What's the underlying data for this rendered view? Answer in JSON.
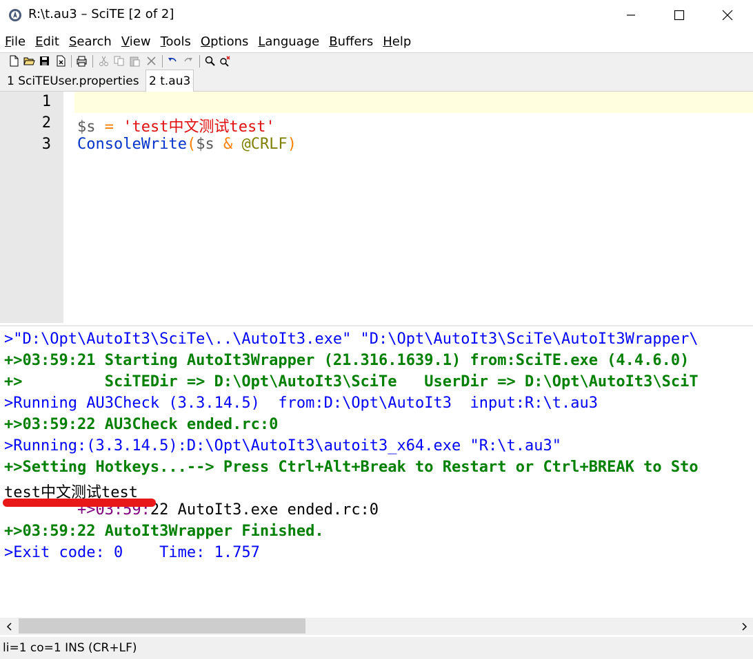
{
  "window": {
    "title": "R:\\t.au3 – SciTE [2 of 2]"
  },
  "menu": [
    {
      "mn": "F",
      "rest": "ile"
    },
    {
      "mn": "E",
      "rest": "dit"
    },
    {
      "mn": "S",
      "rest": "earch"
    },
    {
      "mn": "V",
      "rest": "iew"
    },
    {
      "mn": "T",
      "rest": "ools"
    },
    {
      "mn": "O",
      "rest": "ptions"
    },
    {
      "mn": "L",
      "rest": "anguage"
    },
    {
      "mn": "B",
      "rest": "uffers"
    },
    {
      "mn": "H",
      "rest": "elp"
    }
  ],
  "tabs": [
    {
      "label": "1 SciTEUser.properties"
    },
    {
      "label": "2 t.au3"
    }
  ],
  "editor": {
    "line_numbers": [
      "1",
      "2",
      "3"
    ],
    "line2": {
      "var": "$s",
      "eq": " = ",
      "str": "'test中文测试test'"
    },
    "line3": {
      "fn": "ConsoleWrite",
      "lp": "(",
      "var": "$s",
      "amp": " & ",
      "macro": "@CRLF",
      "rp": ")"
    }
  },
  "output": {
    "lines": [
      {
        "text": ">\"D:\\Opt\\AutoIt3\\SciTe\\..\\AutoIt3.exe\" \"D:\\Opt\\AutoIt3\\SciTe\\AutoIt3Wrapper\\",
        "style": "blue"
      },
      {
        "text": "+>03:59:21 Starting AutoIt3Wrapper (21.316.1639.1) from:SciTE.exe (4.4.6.0)",
        "style": "green"
      },
      {
        "text": "+>         SciTEDir => D:\\Opt\\AutoIt3\\SciTe   UserDir => D:\\Opt\\AutoIt3\\SciT",
        "style": "green"
      },
      {
        "text": ">Running AU3Check (3.3.14.5)  from:D:\\Opt\\AutoIt3  input:R:\\t.au3",
        "style": "blue"
      },
      {
        "text": "+>03:59:22 AU3Check ended.rc:0",
        "style": "green"
      },
      {
        "text": ">Running:(3.3.14.5):D:\\Opt\\AutoIt3\\autoit3_x64.exe \"R:\\t.au3\"",
        "style": "blue"
      },
      {
        "text": "+>Setting Hotkeys...--> Press Ctrl+Alt+Break to Restart or Ctrl+BREAK to Sto",
        "style": "green"
      },
      {
        "text": "test中文测试test",
        "style": "black"
      },
      {
        "text_a": "        +>03:59:",
        "text_b": "22 AutoIt3.exe ended.rc:0",
        "style": "mixed"
      },
      {
        "text": "+>03:59:22 AutoIt3Wrapper Finished.",
        "style": "green"
      },
      {
        "text": ">Exit code: 0    Time: 1.757",
        "style": "blue"
      }
    ]
  },
  "status": {
    "text": "li=1 co=1 INS (CR+LF)"
  },
  "colors": {
    "gutter": "#e8e8e8",
    "caret_line": "#ffffe0",
    "output_blue": "#0000ff",
    "output_green": "#008000",
    "annotation_red": "#e81818"
  }
}
